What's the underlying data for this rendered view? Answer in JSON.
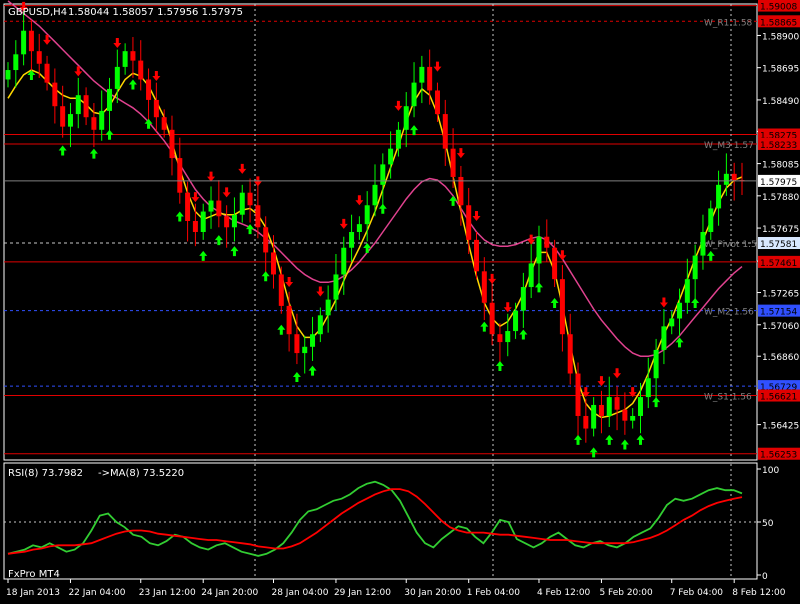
{
  "title_bar": {
    "symbol_label": "GBPUSD,H4",
    "ohlc": "1.58044 1.58057 1.57956 1.57975"
  },
  "indicator_header": {
    "rsi_label": "RSI(8) 73.7982",
    "ma_label": "->MA(8) 73.5220"
  },
  "broker_label": "FxPro MT4",
  "colors": {
    "background": "#000000",
    "frame": "#ffffff",
    "bull_candle": "#00ff00",
    "bear_candle": "#ff0000",
    "ma_fast": "#ffd700",
    "ma_slow": "#e0428f",
    "up_arrow": "#00ff00",
    "down_arrow": "#ff0000",
    "red_level": "#e00000",
    "blue_level": "#3050ff",
    "white_dashed": "#c8c8c8",
    "rsi_line": "#32cd32",
    "rsi_ma": "#ff0000"
  },
  "chart_data": [
    {
      "type": "candlestick",
      "title": "GBPUSD,H4",
      "ylim": [
        1.562,
        1.591
      ],
      "y_ticks": [
        1.56425,
        1.56645,
        1.5686,
        1.5706,
        1.57265,
        1.57465,
        1.57675,
        1.5788,
        1.58085,
        1.5829,
        1.5849,
        1.58695,
        1.589
      ],
      "y_tick_labels": [
        "1.56425",
        "1.56645",
        "1.56860",
        "1.57060",
        "1.57265",
        "1.57465",
        "1.57675",
        "1.57880",
        "1.58085",
        "1.58290",
        "1.58490",
        "1.58695",
        "1.58900"
      ],
      "x_tick_labels": [
        "18 Jan 2013",
        "22 Jan 04:00",
        "23 Jan 12:00",
        "24 Jan 20:00",
        "28 Jan 04:00",
        "29 Jan 12:00",
        "30 Jan 20:00",
        "1 Feb 04:00",
        "4 Feb 12:00",
        "5 Feb 20:00",
        "7 Feb 04:00",
        "8 Feb 12:00"
      ],
      "x_tick_index": [
        0,
        8,
        17,
        25,
        34,
        42,
        51,
        59,
        68,
        76,
        85,
        93
      ],
      "levels": [
        {
          "price": 1.5899,
          "label": "W_R1 1.58",
          "style": "red-dashed",
          "badge": "1.58865"
        },
        {
          "price": 1.5909,
          "label": "",
          "style": "red-solid",
          "badge": "1.59008"
        },
        {
          "price": 1.5827,
          "label": "",
          "style": "red-solid",
          "badge": "1.58275"
        },
        {
          "price": 1.5821,
          "label": "W_M3 1.57",
          "style": "red-solid",
          "badge": "1.58233"
        },
        {
          "price": 1.5758,
          "label": "W_Pivot 1.5",
          "style": "white-dashed",
          "badge": "1.57581"
        },
        {
          "price": 1.5746,
          "label": "",
          "style": "red-solid",
          "badge": "1.57461"
        },
        {
          "price": 1.5715,
          "label": "W_M2 1.56",
          "style": "blue-dashed",
          "badge": "1.57154"
        },
        {
          "price": 1.5667,
          "label": "",
          "style": "blue-dashed",
          "badge": "1.56729"
        },
        {
          "price": 1.5661,
          "label": "W_S1 1.56",
          "style": "red-solid",
          "badge": "1.56621"
        },
        {
          "price": 1.5624,
          "label": "",
          "style": "red-solid",
          "badge": "1.56253"
        }
      ],
      "current_price": {
        "price": 1.57975,
        "badge": "1.57975"
      },
      "closes": [
        1.5868,
        1.5878,
        1.5893,
        1.588,
        1.5872,
        1.586,
        1.5845,
        1.5832,
        1.584,
        1.5852,
        1.5838,
        1.583,
        1.5842,
        1.5856,
        1.587,
        1.588,
        1.5874,
        1.5862,
        1.5849,
        1.5838,
        1.583,
        1.5812,
        1.579,
        1.5772,
        1.5765,
        1.5778,
        1.5785,
        1.5775,
        1.5768,
        1.5776,
        1.579,
        1.5782,
        1.5768,
        1.5752,
        1.5738,
        1.5718,
        1.57,
        1.5688,
        1.5692,
        1.57,
        1.5712,
        1.5722,
        1.5738,
        1.5755,
        1.5765,
        1.577,
        1.5782,
        1.5795,
        1.5808,
        1.5818,
        1.583,
        1.5845,
        1.586,
        1.587,
        1.5855,
        1.584,
        1.5818,
        1.58,
        1.5782,
        1.576,
        1.574,
        1.572,
        1.57,
        1.5695,
        1.5702,
        1.5715,
        1.573,
        1.5745,
        1.5762,
        1.5755,
        1.5735,
        1.57,
        1.5675,
        1.5648,
        1.564,
        1.5655,
        1.5648,
        1.566,
        1.5652,
        1.5645,
        1.5648,
        1.566,
        1.5672,
        1.569,
        1.5705,
        1.571,
        1.572,
        1.5735,
        1.575,
        1.5765,
        1.578,
        1.5795,
        1.5802,
        1.5798,
        1.57975
      ],
      "ma_fast": [
        1.585,
        1.5858,
        1.5865,
        1.5868,
        1.5866,
        1.5861,
        1.5856,
        1.5852,
        1.585,
        1.585,
        1.5846,
        1.5841,
        1.584,
        1.5845,
        1.5854,
        1.5862,
        1.5866,
        1.5864,
        1.5858,
        1.5848,
        1.5838,
        1.5822,
        1.5805,
        1.579,
        1.5778,
        1.5773,
        1.5775,
        1.5777,
        1.5776,
        1.5776,
        1.5779,
        1.578,
        1.5776,
        1.5768,
        1.5755,
        1.5738,
        1.572,
        1.5705,
        1.5698,
        1.5698,
        1.5703,
        1.5712,
        1.5722,
        1.5734,
        1.5745,
        1.5755,
        1.5766,
        1.5778,
        1.5792,
        1.5806,
        1.582,
        1.5835,
        1.5848,
        1.5856,
        1.5852,
        1.584,
        1.5822,
        1.58,
        1.5778,
        1.5757,
        1.5737,
        1.572,
        1.571,
        1.5705,
        1.5708,
        1.5716,
        1.5726,
        1.574,
        1.5752,
        1.5752,
        1.574,
        1.5718,
        1.5693,
        1.567,
        1.5656,
        1.565,
        1.5647,
        1.5648,
        1.565,
        1.5652,
        1.5656,
        1.5664,
        1.5675,
        1.5688,
        1.57,
        1.571,
        1.5722,
        1.5735,
        1.5748,
        1.576,
        1.5772,
        1.5784,
        1.5793,
        1.5798,
        1.58
      ],
      "ma_slow": [
        1.5912,
        1.5908,
        1.5904,
        1.59,
        1.5896,
        1.5891,
        1.5886,
        1.5881,
        1.5876,
        1.5871,
        1.5866,
        1.5861,
        1.5857,
        1.5853,
        1.585,
        1.5847,
        1.5844,
        1.584,
        1.5835,
        1.5829,
        1.5823,
        1.5816,
        1.5808,
        1.58,
        1.5792,
        1.5786,
        1.5781,
        1.5778,
        1.5775,
        1.5772,
        1.577,
        1.5768,
        1.5765,
        1.5761,
        1.5757,
        1.5752,
        1.5747,
        1.5742,
        1.5738,
        1.5735,
        1.5733,
        1.5733,
        1.5734,
        1.5737,
        1.5741,
        1.5746,
        1.5752,
        1.5758,
        1.5765,
        1.5772,
        1.5779,
        1.5786,
        1.5792,
        1.5797,
        1.5799,
        1.5798,
        1.5794,
        1.5788,
        1.578,
        1.5772,
        1.5765,
        1.576,
        1.5757,
        1.5756,
        1.5756,
        1.5757,
        1.5759,
        1.5761,
        1.5762,
        1.576,
        1.5755,
        1.5748,
        1.574,
        1.5732,
        1.5724,
        1.5716,
        1.5709,
        1.5703,
        1.5697,
        1.5692,
        1.5688,
        1.5686,
        1.5686,
        1.5687,
        1.569,
        1.5694,
        1.5699,
        1.5705,
        1.5711,
        1.5717,
        1.5723,
        1.5729,
        1.5734,
        1.5739,
        1.5743
      ],
      "up_arrows": [
        3,
        7,
        11,
        13,
        16,
        18,
        22,
        25,
        27,
        29,
        31,
        33,
        35,
        37,
        39,
        46,
        48,
        52,
        57,
        61,
        63,
        66,
        68,
        70,
        73,
        75,
        77,
        79,
        81,
        83,
        86,
        88,
        90
      ],
      "down_arrows": [
        2,
        5,
        9,
        14,
        19,
        24,
        26,
        28,
        30,
        32,
        36,
        40,
        43,
        45,
        50,
        55,
        58,
        60,
        62,
        64,
        67,
        71,
        74,
        76,
        78,
        80,
        84
      ]
    },
    {
      "type": "line",
      "title": "RSI(8)",
      "ylim": [
        0,
        100
      ],
      "y_ticks": [
        0,
        50,
        100
      ],
      "y_tick_labels": [
        "0",
        "50",
        "100"
      ],
      "series": [
        {
          "name": "RSI(8)",
          "values": [
            20,
            22,
            24,
            28,
            26,
            30,
            26,
            22,
            24,
            30,
            42,
            56,
            58,
            50,
            45,
            38,
            36,
            30,
            28,
            32,
            38,
            36,
            30,
            26,
            24,
            28,
            30,
            26,
            22,
            20,
            18,
            20,
            24,
            30,
            40,
            52,
            60,
            62,
            66,
            70,
            72,
            76,
            82,
            86,
            88,
            85,
            80,
            70,
            55,
            40,
            30,
            26,
            34,
            40,
            46,
            44,
            36,
            30,
            40,
            52,
            50,
            34,
            30,
            26,
            30,
            36,
            40,
            34,
            28,
            26,
            30,
            32,
            28,
            26,
            30,
            36,
            40,
            44,
            54,
            66,
            72,
            70,
            72,
            76,
            80,
            82,
            80,
            80,
            77
          ]
        },
        {
          "name": "MA(8)",
          "values": [
            20,
            21,
            22,
            24,
            25,
            27,
            28,
            28,
            28,
            29,
            30,
            33,
            36,
            39,
            41,
            42,
            42,
            41,
            39,
            38,
            37,
            36,
            35,
            34,
            33,
            33,
            32,
            31,
            30,
            29,
            27,
            26,
            25,
            25,
            27,
            30,
            35,
            40,
            46,
            52,
            58,
            63,
            68,
            72,
            76,
            79,
            81,
            81,
            79,
            74,
            67,
            59,
            51,
            45,
            42,
            40,
            40,
            40,
            39,
            38,
            38,
            37,
            36,
            35,
            34,
            33,
            33,
            33,
            32,
            31,
            30,
            30,
            30,
            30,
            30,
            31,
            33,
            35,
            38,
            42,
            47,
            52,
            56,
            61,
            65,
            68,
            70,
            72,
            73.5
          ]
        }
      ]
    }
  ]
}
